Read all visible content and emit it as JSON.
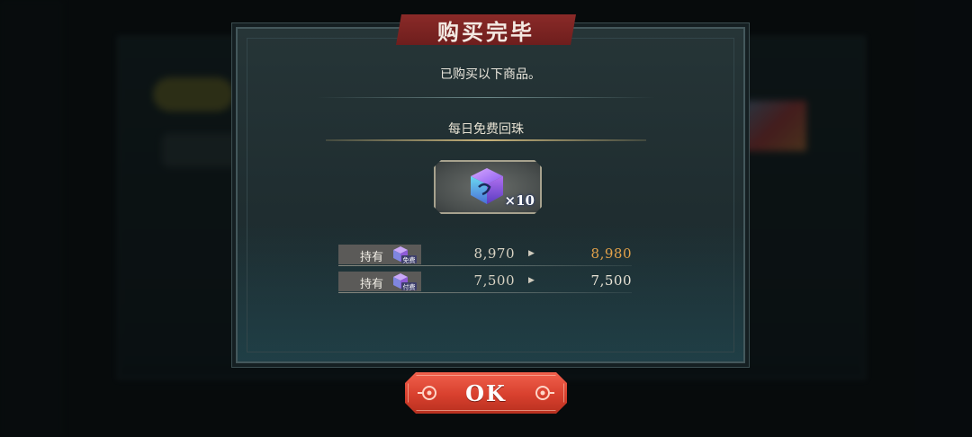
{
  "dialog": {
    "title": "购买完毕",
    "message": "已购买以下商品。",
    "product_name": "每日免费回珠",
    "item": {
      "icon": "crystal-cube-icon",
      "quantity": "×10"
    },
    "rows": [
      {
        "label": "持有",
        "currency_icon": "free-crystal-icon",
        "currency_tag": "免费",
        "from": "8,970",
        "to": "8,980",
        "to_color": "#e3a24a"
      },
      {
        "label": "持有",
        "currency_icon": "paid-crystal-icon",
        "currency_tag": "付费",
        "from": "7,500",
        "to": "7,500",
        "to_color": "#e9e4d6"
      }
    ],
    "ok_label": "OK"
  },
  "colors": {
    "title_banner": "#7a2422",
    "ok_button": "#d8402e",
    "highlight_value": "#e3a24a"
  }
}
